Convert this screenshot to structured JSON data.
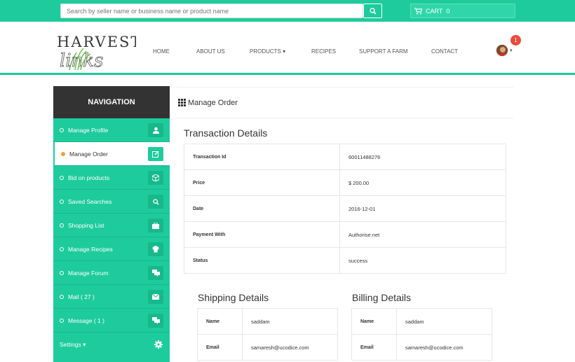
{
  "topbar": {
    "search_placeholder": "Search by seller name or business name or product name",
    "cart_label": "CART",
    "cart_count": "0"
  },
  "brand": {
    "logo_text": "Harvest Links"
  },
  "nav": {
    "items": [
      "HOME",
      "ABOUT US",
      "PRODUCTS",
      "RECIPES",
      "SUPPORT A FARM",
      "CONTACT"
    ]
  },
  "user": {
    "notification_count": "1"
  },
  "sidebar": {
    "title": "NAVIGATION",
    "items": [
      {
        "label": "Manage Profile",
        "icon": "user-icon"
      },
      {
        "label": "Manage Order",
        "icon": "edit-icon"
      },
      {
        "label": "Bid on products",
        "icon": "cube-icon"
      },
      {
        "label": "Saved Searches",
        "icon": "search-icon"
      },
      {
        "label": "Shopping List",
        "icon": "briefcase-icon"
      },
      {
        "label": "Manage Recipes",
        "icon": "chef-hat-icon"
      },
      {
        "label": "Manage Forum",
        "icon": "comments-icon"
      },
      {
        "label": "Mail ( 27 )",
        "icon": "envelope-icon"
      },
      {
        "label": "Message ( 1 )",
        "icon": "comments-icon"
      }
    ],
    "settings_label": "Settings"
  },
  "page": {
    "title": "Manage Order"
  },
  "transaction": {
    "heading": "Transaction Details",
    "rows": [
      {
        "key": "Transaction Id",
        "value": "60011488276"
      },
      {
        "key": "Price",
        "value": "$ 200.00"
      },
      {
        "key": "Date",
        "value": "2016-12-01"
      },
      {
        "key": "Payment With",
        "value": "Authorise.net"
      },
      {
        "key": "Status",
        "value": "success"
      }
    ]
  },
  "shipping": {
    "heading": "Shipping Details",
    "rows": [
      {
        "key": "Name",
        "value": "saddam"
      },
      {
        "key": "Email",
        "value": "samaresh@ucodice.com"
      }
    ]
  },
  "billing": {
    "heading": "Billing Details",
    "rows": [
      {
        "key": "Name",
        "value": "saddam"
      },
      {
        "key": "Email",
        "value": "samaresh@ucodice.com"
      }
    ]
  }
}
